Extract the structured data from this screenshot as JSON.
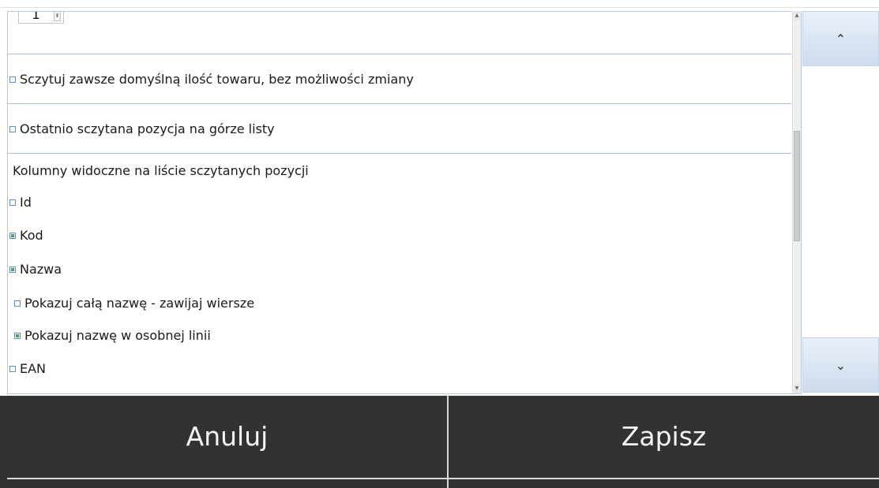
{
  "quantity": {
    "value": "1",
    "arrows_glyph": "⬍"
  },
  "options": [
    {
      "label": "Sczytuj zawsze domyślną ilość towaru, bez możliwości zmiany",
      "checked": false
    },
    {
      "label": "Ostatnio sczytana pozycja na górze listy",
      "checked": false
    }
  ],
  "columns": {
    "title": "Kolumny widoczne na liście sczytanych pozycji",
    "items": [
      {
        "label": "Id",
        "checked": false
      },
      {
        "label": "Kod",
        "checked": true
      },
      {
        "label": "Nazwa",
        "checked": true
      },
      {
        "label": "Pokazuj całą nazwę - zawijaj wiersze",
        "checked": false
      },
      {
        "label": "Pokazuj nazwę w osobnej linii",
        "checked": true
      },
      {
        "label": "EAN",
        "checked": false
      }
    ]
  },
  "scroll": {
    "up_icon": "⌃",
    "down_icon": "⌄",
    "small_up": "▲",
    "small_down": "▼"
  },
  "footer": {
    "cancel": "Anuluj",
    "save": "Zapisz"
  }
}
